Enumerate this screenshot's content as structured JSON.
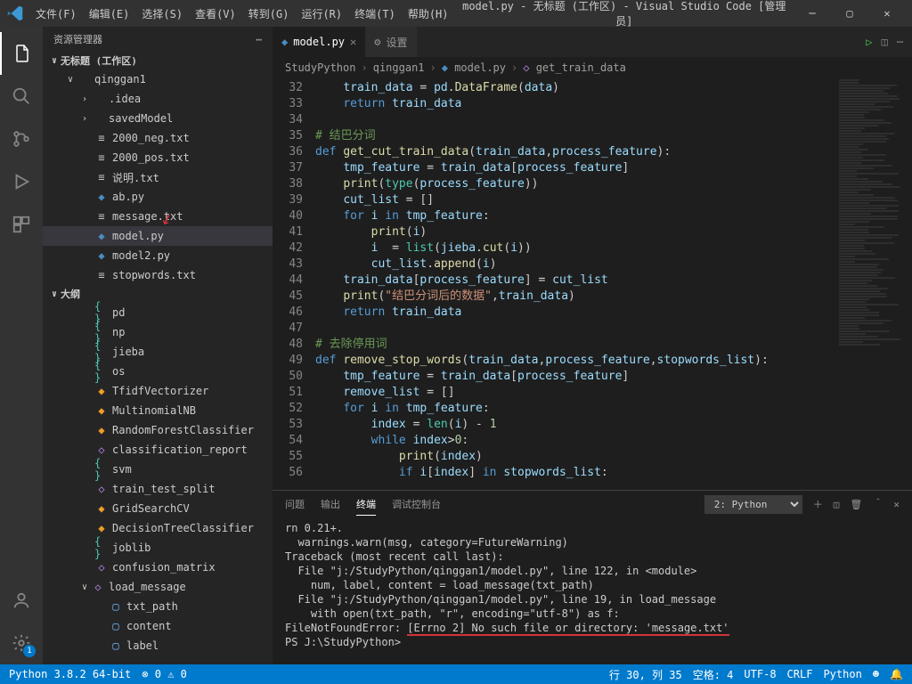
{
  "title": "model.py - 无标题 (工作区) - Visual Studio Code [管理员]",
  "menus": [
    "文件(F)",
    "编辑(E)",
    "选择(S)",
    "查看(V)",
    "转到(G)",
    "运行(R)",
    "终端(T)",
    "帮助(H)"
  ],
  "sidebar": {
    "header": "资源管理器",
    "workspace": "无标题 (工作区)",
    "items": [
      {
        "t": "qinggan1",
        "lvl": "l1",
        "i": "fld",
        "chev": "∨"
      },
      {
        "t": ".idea",
        "lvl": "l2",
        "i": "fld",
        "chev": "›"
      },
      {
        "t": "savedModel",
        "lvl": "l2",
        "i": "fld",
        "chev": "›"
      },
      {
        "t": "2000_neg.txt",
        "lvl": "l2",
        "i": "txt"
      },
      {
        "t": "2000_pos.txt",
        "lvl": "l2",
        "i": "txt"
      },
      {
        "t": "说明.txt",
        "lvl": "l2",
        "i": "txt"
      },
      {
        "t": "ab.py",
        "lvl": "l2",
        "i": "py"
      },
      {
        "t": "message.txt",
        "lvl": "l2",
        "i": "txt"
      },
      {
        "t": "model.py",
        "lvl": "l2",
        "i": "py",
        "sel": true
      },
      {
        "t": "model2.py",
        "lvl": "l2",
        "i": "py"
      },
      {
        "t": "stopwords.txt",
        "lvl": "l2",
        "i": "txt"
      }
    ],
    "outline_title": "大纲",
    "outline": [
      {
        "t": "pd",
        "i": "mod"
      },
      {
        "t": "np",
        "i": "mod"
      },
      {
        "t": "jieba",
        "i": "mod"
      },
      {
        "t": "os",
        "i": "mod"
      },
      {
        "t": "TfidfVectorizer",
        "i": "cls"
      },
      {
        "t": "MultinomialNB",
        "i": "cls"
      },
      {
        "t": "RandomForestClassifier",
        "i": "cls"
      },
      {
        "t": "classification_report",
        "i": "fn"
      },
      {
        "t": "svm",
        "i": "mod"
      },
      {
        "t": "train_test_split",
        "i": "fn"
      },
      {
        "t": "GridSearchCV",
        "i": "cls"
      },
      {
        "t": "DecisionTreeClassifier",
        "i": "cls"
      },
      {
        "t": "joblib",
        "i": "mod"
      },
      {
        "t": "confusion_matrix",
        "i": "fn"
      },
      {
        "t": "load_message",
        "i": "fn",
        "chev": "∨"
      },
      {
        "t": "txt_path",
        "i": "var",
        "lvl": "l3"
      },
      {
        "t": "content",
        "i": "var",
        "lvl": "l3"
      },
      {
        "t": "label",
        "i": "var",
        "lvl": "l3"
      }
    ]
  },
  "tabs": [
    {
      "label": "model.py",
      "active": true,
      "icon": "py"
    },
    {
      "label": "设置",
      "active": false,
      "icon": "gear"
    }
  ],
  "breadcrumb": [
    "StudyPython",
    "qinggan1",
    "model.py",
    "get_train_data"
  ],
  "gutter_start": 32,
  "gutter_end": 56,
  "terminal": {
    "tabs": [
      "问题",
      "输出",
      "终端",
      "调试控制台"
    ],
    "active": 2,
    "dropdown": "2: Python",
    "lines": [
      "rn 0.21+.",
      "  warnings.warn(msg, category=FutureWarning)",
      "Traceback (most recent call last):",
      "  File \"j:/StudyPython/qinggan1/model.py\", line 122, in <module>",
      "    num, label, content = load_message(txt_path)",
      "  File \"j:/StudyPython/qinggan1/model.py\", line 19, in load_message",
      "    with open(txt_path, \"r\", encoding=\"utf-8\") as f:",
      "FileNotFoundError: [Errno 2] No such file or directory: 'message.txt'",
      "PS J:\\StudyPython>"
    ],
    "underline_line": 7
  },
  "status": {
    "python": "Python 3.8.2 64-bit",
    "errors": "0",
    "warnings": "0",
    "line": "行 30,  列 35",
    "spaces": "空格: 4",
    "encoding": "UTF-8",
    "eol": "CRLF",
    "lang": "Python"
  }
}
